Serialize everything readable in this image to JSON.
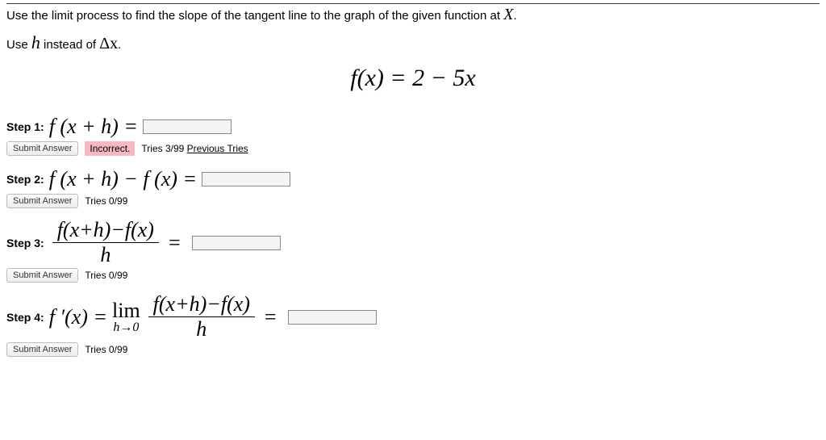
{
  "instruction": "Use the limit process to find the slope of the tangent line to the graph of the given function at",
  "instruction_var": "X",
  "sub_instruction_pre": "Use",
  "sub_instruction_h": "h",
  "sub_instruction_mid": "instead of",
  "sub_instruction_dx": "Δx",
  "main_equation": "f(x) = 2 − 5x",
  "submit_label": "Submit Answer",
  "incorrect_label": "Incorrect.",
  "previous_tries_label": "Previous Tries",
  "steps": {
    "s1": {
      "label": "Step 1:",
      "expr": "f (x + h) =",
      "tries": "Tries 3/99",
      "show_incorrect": true,
      "show_prev": true
    },
    "s2": {
      "label": "Step 2:",
      "expr": "f (x + h) − f (x) =",
      "tries": "Tries 0/99"
    },
    "s3": {
      "label": "Step 3:",
      "frac_num": "f(x+h)−f(x)",
      "frac_den": "h",
      "tries": "Tries 0/99"
    },
    "s4": {
      "label": "Step 4:",
      "lhs": "f ′(x) =",
      "lim_top": "lim",
      "lim_bot": "h→0",
      "frac_num": "f(x+h)−f(x)",
      "frac_den": "h",
      "tries": "Tries 0/99"
    }
  }
}
